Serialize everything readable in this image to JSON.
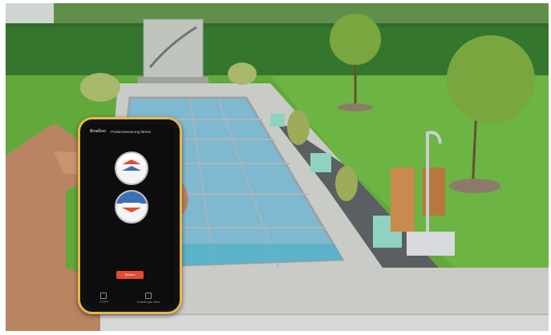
{
  "app": {
    "brand": "Rradiso",
    "screen_title": "Positionsteuerung fahren",
    "primary_button": "Starten",
    "nav_left": "STOPP",
    "nav_right": "Einstellungen öffnen"
  },
  "colors": {
    "lawn": "#62a83b",
    "hedge": "#2f6b2a",
    "pool_cover": "#8ec6d8",
    "accent_red": "#e64b2f",
    "phone_frame": "#e6b84a"
  },
  "controls": {
    "upper_icon": "arrows-up-icon",
    "lower_icon": "arrows-down-icon"
  }
}
